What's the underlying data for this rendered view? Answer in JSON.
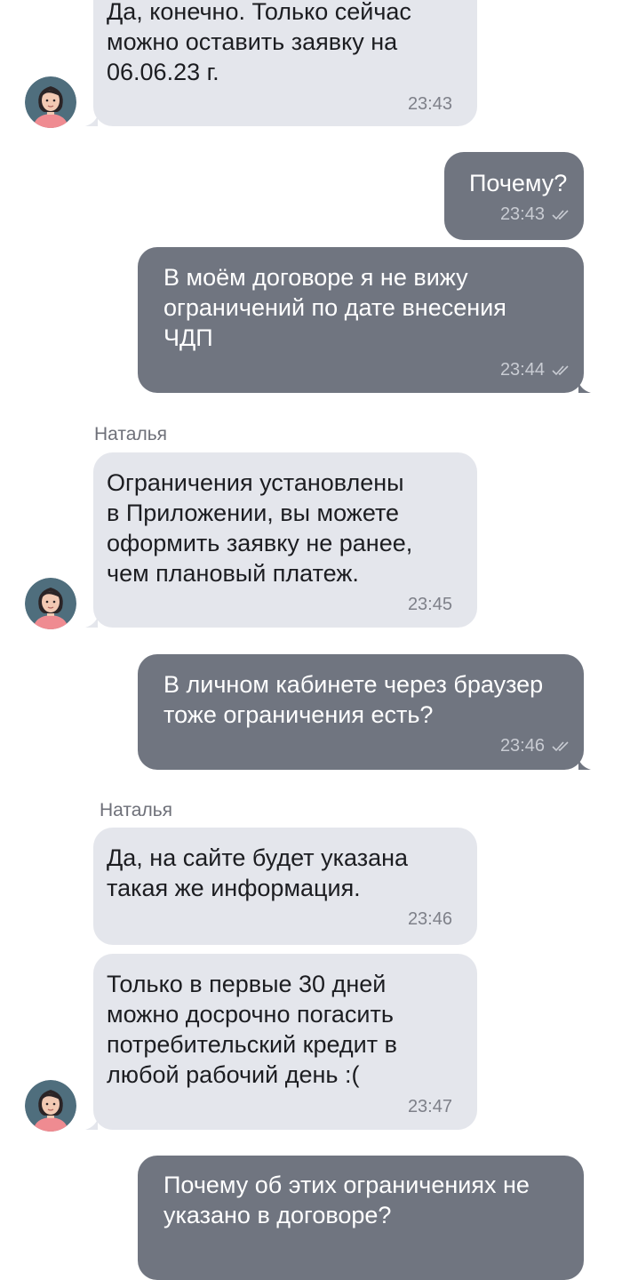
{
  "chat": {
    "sender_names": [
      "Наталья",
      "Наталья"
    ],
    "messages": [
      {
        "direction": "incoming",
        "text": "Да, конечно. Только сейчас\nможно оставить заявку на\n06.06.23 г.",
        "time": "23:43"
      },
      {
        "direction": "outgoing",
        "text": "Почему?",
        "time": "23:43",
        "status": "read"
      },
      {
        "direction": "outgoing",
        "text": "В моём договоре я не вижу\nограничений по дате внесения\nЧДП",
        "time": "23:44",
        "status": "read"
      },
      {
        "direction": "incoming",
        "text": "Ограничения установлены\nв Приложении, вы можете\nоформить заявку не ранее,\nчем плановый платеж.",
        "time": "23:45"
      },
      {
        "direction": "outgoing",
        "text": "В личном кабинете через браузер\nтоже ограничения есть?",
        "time": "23:46",
        "status": "read"
      },
      {
        "direction": "incoming",
        "text": "Да, на сайте будет указана\nтакая же информация.",
        "time": "23:46"
      },
      {
        "direction": "incoming",
        "text": "Только в первые 30 дней\nможно досрочно погасить\nпотребительский кредит в\nлюбой рабочий день :(",
        "time": "23:47"
      },
      {
        "direction": "outgoing",
        "text": "Почему об этих ограничениях не\nуказано в договоре?"
      }
    ]
  },
  "avatar": {
    "icon": "operator-avatar-icon",
    "colors": {
      "background": "#4f6e7d",
      "skin": "#f2c9b3",
      "hair": "#2b2426",
      "shirt": "#ef8b91"
    }
  },
  "colors": {
    "incoming_bubble": "#e4e6ec",
    "outgoing_bubble": "#707580",
    "incoming_text": "#1c1d21",
    "outgoing_text": "#ffffff",
    "incoming_time": "#7e8089",
    "outgoing_time": "#c9ccd3",
    "sender_name": "#6e7079"
  }
}
